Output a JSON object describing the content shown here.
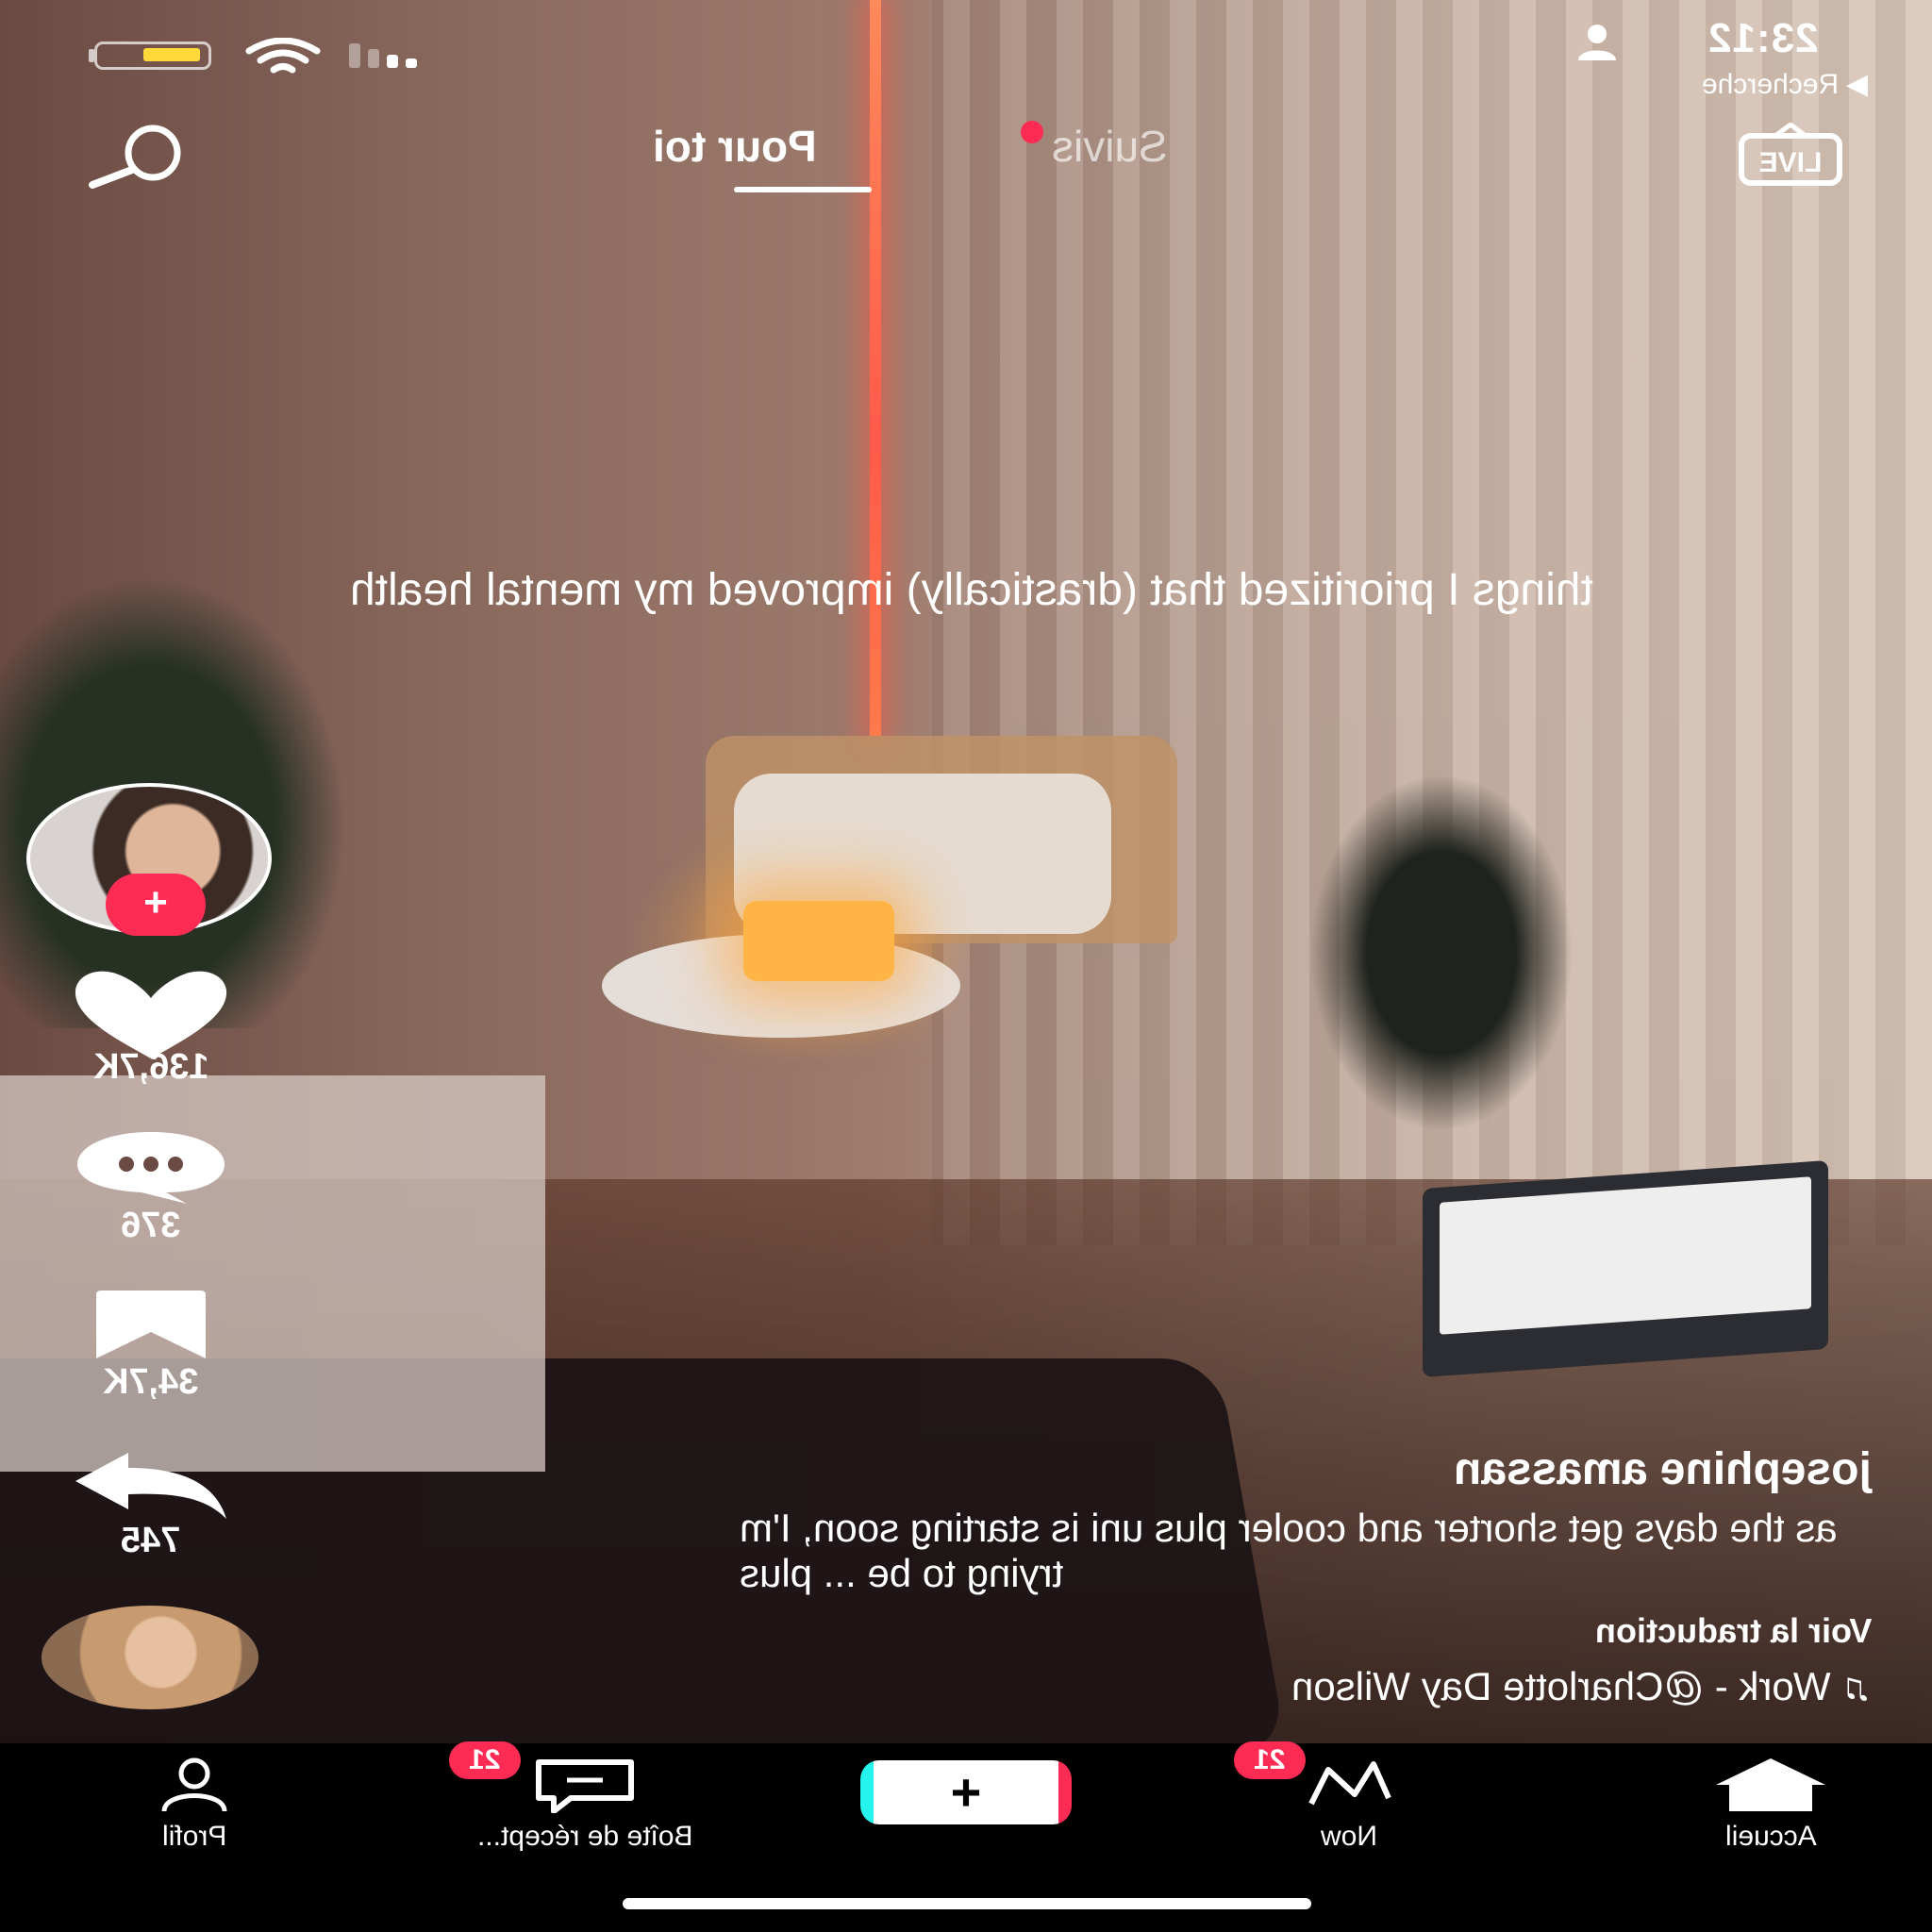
{
  "status_bar": {
    "time": "23:12",
    "back_app": "Recherche"
  },
  "top_tabs": {
    "active": "Pour toi",
    "inactive": "Suivis",
    "live_label": "LIVE"
  },
  "video": {
    "overlay_caption": "things I prioritized that (drastically) improved my mental health",
    "author": "josephine amassan",
    "description": "as the days get shorter and cooler plus uni is starting soon, I'm trying to be ... plus",
    "translate_link": "Voir la traduction",
    "music": "Work - @Charlotte Day Wilson",
    "music_note": "♫"
  },
  "actions": {
    "follow_plus": "+",
    "likes": "136,7K",
    "comments": "376",
    "saves": "34,7K",
    "shares": "745"
  },
  "bottom_nav": {
    "items": [
      {
        "label": "Accueil",
        "icon": "home-icon"
      },
      {
        "label": "Now",
        "icon": "now-icon",
        "badge": "21"
      },
      {
        "label": "+",
        "icon": "create-icon"
      },
      {
        "label": "Boîte de récept...",
        "icon": "inbox-icon",
        "badge": "21"
      },
      {
        "label": "Profil",
        "icon": "profile-icon"
      }
    ]
  },
  "colors": {
    "accent": "#fe2c55",
    "cyan": "#25f4ee",
    "battery": "#ffd83a"
  }
}
